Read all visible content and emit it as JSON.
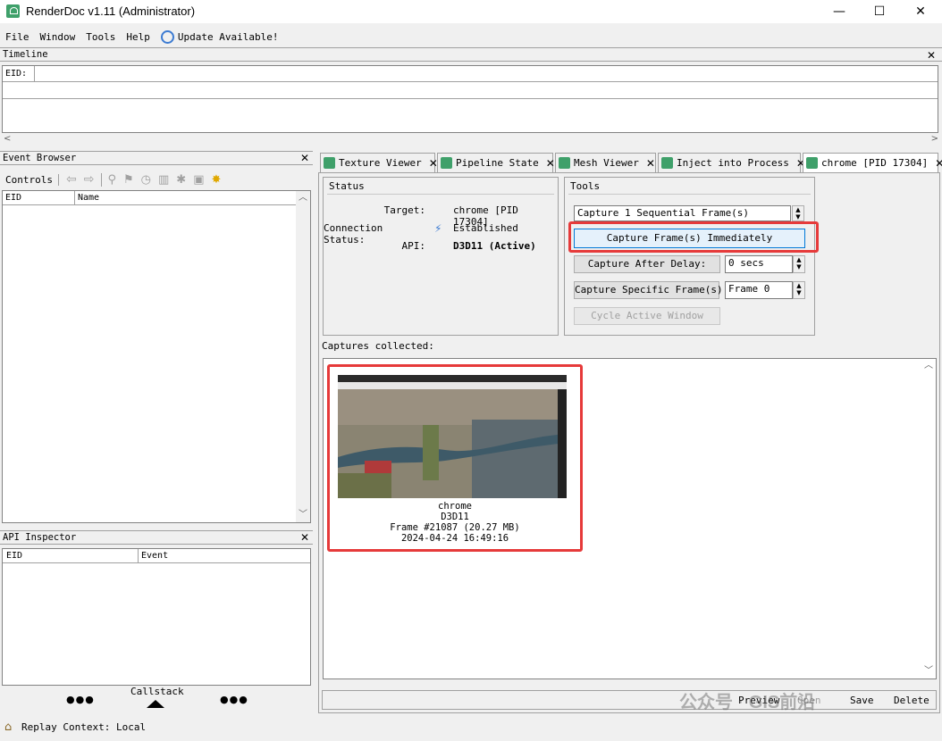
{
  "window": {
    "title": "RenderDoc v1.11 (Administrator)",
    "minimize": "—",
    "maximize": "☐",
    "close": "✕"
  },
  "menu": {
    "items": [
      "File",
      "Window",
      "Tools",
      "Help"
    ],
    "update": "Update Available!"
  },
  "timeline": {
    "title": "Timeline",
    "eid_label": "EID:"
  },
  "event_browser": {
    "title": "Event Browser",
    "controls_label": "Controls",
    "columns": [
      "EID",
      "Name"
    ]
  },
  "api_inspector": {
    "title": "API Inspector",
    "columns": [
      "EID",
      "Event"
    ],
    "callstack_label": "Callstack",
    "dots": "●●●"
  },
  "tabs": [
    {
      "label": "Texture Viewer"
    },
    {
      "label": "Pipeline State"
    },
    {
      "label": "Mesh Viewer"
    },
    {
      "label": "Inject into Process"
    },
    {
      "label": "chrome [PID 17304]"
    }
  ],
  "status": {
    "title": "Status",
    "target_label": "Target:",
    "target_value": "chrome [PID 17304]",
    "connection_label": "Connection Status:",
    "connection_value": "Established",
    "api_label": "API:",
    "api_value": "D3D11 (Active)"
  },
  "tools": {
    "title": "Tools",
    "sequential_value": "Capture 1 Sequential Frame(s)",
    "capture_now": "Capture Frame(s) Immediately",
    "capture_delay": "Capture After Delay:",
    "delay_value": "0 secs",
    "capture_specific": "Capture Specific Frame(s):",
    "frame_value": "Frame 0",
    "cycle_window": "Cycle Active Window"
  },
  "captures": {
    "label": "Captures collected:",
    "items": [
      {
        "name": "chrome",
        "api": "D3D11",
        "frame": "Frame #21087 (20.27 MB)",
        "timestamp": "2024-04-24 16:49:16"
      }
    ]
  },
  "bottom_buttons": {
    "preview": "Preview",
    "open": "Open",
    "save": "Save",
    "delete": "Delete"
  },
  "watermark": "公众号 · GIS前沿",
  "statusbar": {
    "text": "Replay Context: Local"
  },
  "colors": {
    "accent": "#3fa06a",
    "highlight": "#e63a3a",
    "selection_border": "#0078d7"
  }
}
